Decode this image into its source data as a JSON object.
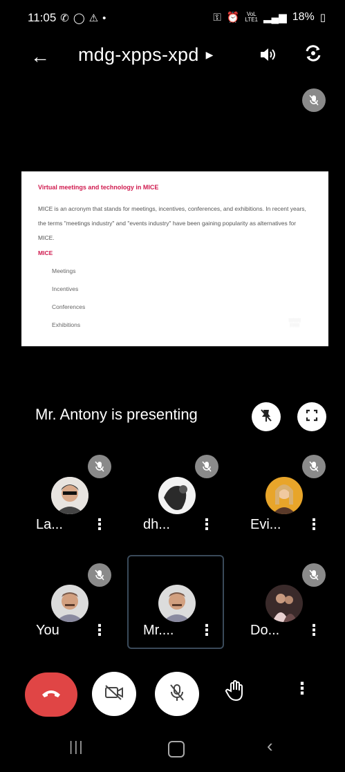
{
  "status_bar": {
    "time": "11:05",
    "volte_line1": "VoL",
    "volte_line2": "LTE1",
    "battery": "18%"
  },
  "top_bar": {
    "meeting_code": "mdg-xpps-xpd"
  },
  "slide": {
    "title": "Virtual meetings and technology in MICE",
    "body": "MICE is an acronym that stands for meetings, incentives, conferences, and exhibitions. In recent years, the terms \"meetings industry\" and \"events industry\" have been gaining popularity as alternatives for MICE.",
    "subtitle": "MICE",
    "items": [
      "Meetings",
      "Incentives",
      "Conferences",
      "Exhibitions"
    ]
  },
  "presenting": {
    "text": "Mr. Antony is presenting"
  },
  "participants": [
    {
      "name": "La...",
      "muted": true
    },
    {
      "name": "dh...",
      "muted": true
    },
    {
      "name": "Evi...",
      "muted": true
    },
    {
      "name": "You",
      "muted": true
    },
    {
      "name": "Mr....",
      "muted": false,
      "selected": true
    },
    {
      "name": "Do...",
      "muted": true
    }
  ],
  "colors": {
    "end_call": "#e04545",
    "slide_accent": "#d01b4f",
    "mute_badge": "#8a8a8a",
    "selected_border": "#3a4a5a"
  },
  "icons": {
    "back": "arrow-left-icon",
    "speaker": "speaker-icon",
    "switch_camera": "switch-camera-icon",
    "muted": "mic-off-icon",
    "pin": "pin-off-icon",
    "fullscreen": "fullscreen-icon",
    "end_call": "phone-hangup-icon",
    "camera": "video-off-icon",
    "mic": "mic-off-icon",
    "raise_hand": "hand-icon",
    "more": "more-vertical-icon"
  }
}
